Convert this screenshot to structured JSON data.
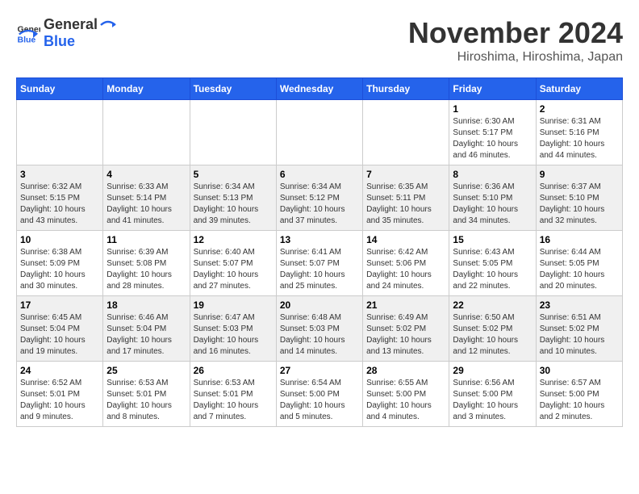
{
  "header": {
    "logo": {
      "general": "General",
      "blue": "Blue"
    },
    "title": "November 2024",
    "location": "Hiroshima, Hiroshima, Japan"
  },
  "calendar": {
    "weekdays": [
      "Sunday",
      "Monday",
      "Tuesday",
      "Wednesday",
      "Thursday",
      "Friday",
      "Saturday"
    ],
    "weeks": [
      [
        {
          "day": "",
          "info": ""
        },
        {
          "day": "",
          "info": ""
        },
        {
          "day": "",
          "info": ""
        },
        {
          "day": "",
          "info": ""
        },
        {
          "day": "",
          "info": ""
        },
        {
          "day": "1",
          "info": "Sunrise: 6:30 AM\nSunset: 5:17 PM\nDaylight: 10 hours\nand 46 minutes."
        },
        {
          "day": "2",
          "info": "Sunrise: 6:31 AM\nSunset: 5:16 PM\nDaylight: 10 hours\nand 44 minutes."
        }
      ],
      [
        {
          "day": "3",
          "info": "Sunrise: 6:32 AM\nSunset: 5:15 PM\nDaylight: 10 hours\nand 43 minutes."
        },
        {
          "day": "4",
          "info": "Sunrise: 6:33 AM\nSunset: 5:14 PM\nDaylight: 10 hours\nand 41 minutes."
        },
        {
          "day": "5",
          "info": "Sunrise: 6:34 AM\nSunset: 5:13 PM\nDaylight: 10 hours\nand 39 minutes."
        },
        {
          "day": "6",
          "info": "Sunrise: 6:34 AM\nSunset: 5:12 PM\nDaylight: 10 hours\nand 37 minutes."
        },
        {
          "day": "7",
          "info": "Sunrise: 6:35 AM\nSunset: 5:11 PM\nDaylight: 10 hours\nand 35 minutes."
        },
        {
          "day": "8",
          "info": "Sunrise: 6:36 AM\nSunset: 5:10 PM\nDaylight: 10 hours\nand 34 minutes."
        },
        {
          "day": "9",
          "info": "Sunrise: 6:37 AM\nSunset: 5:10 PM\nDaylight: 10 hours\nand 32 minutes."
        }
      ],
      [
        {
          "day": "10",
          "info": "Sunrise: 6:38 AM\nSunset: 5:09 PM\nDaylight: 10 hours\nand 30 minutes."
        },
        {
          "day": "11",
          "info": "Sunrise: 6:39 AM\nSunset: 5:08 PM\nDaylight: 10 hours\nand 28 minutes."
        },
        {
          "day": "12",
          "info": "Sunrise: 6:40 AM\nSunset: 5:07 PM\nDaylight: 10 hours\nand 27 minutes."
        },
        {
          "day": "13",
          "info": "Sunrise: 6:41 AM\nSunset: 5:07 PM\nDaylight: 10 hours\nand 25 minutes."
        },
        {
          "day": "14",
          "info": "Sunrise: 6:42 AM\nSunset: 5:06 PM\nDaylight: 10 hours\nand 24 minutes."
        },
        {
          "day": "15",
          "info": "Sunrise: 6:43 AM\nSunset: 5:05 PM\nDaylight: 10 hours\nand 22 minutes."
        },
        {
          "day": "16",
          "info": "Sunrise: 6:44 AM\nSunset: 5:05 PM\nDaylight: 10 hours\nand 20 minutes."
        }
      ],
      [
        {
          "day": "17",
          "info": "Sunrise: 6:45 AM\nSunset: 5:04 PM\nDaylight: 10 hours\nand 19 minutes."
        },
        {
          "day": "18",
          "info": "Sunrise: 6:46 AM\nSunset: 5:04 PM\nDaylight: 10 hours\nand 17 minutes."
        },
        {
          "day": "19",
          "info": "Sunrise: 6:47 AM\nSunset: 5:03 PM\nDaylight: 10 hours\nand 16 minutes."
        },
        {
          "day": "20",
          "info": "Sunrise: 6:48 AM\nSunset: 5:03 PM\nDaylight: 10 hours\nand 14 minutes."
        },
        {
          "day": "21",
          "info": "Sunrise: 6:49 AM\nSunset: 5:02 PM\nDaylight: 10 hours\nand 13 minutes."
        },
        {
          "day": "22",
          "info": "Sunrise: 6:50 AM\nSunset: 5:02 PM\nDaylight: 10 hours\nand 12 minutes."
        },
        {
          "day": "23",
          "info": "Sunrise: 6:51 AM\nSunset: 5:02 PM\nDaylight: 10 hours\nand 10 minutes."
        }
      ],
      [
        {
          "day": "24",
          "info": "Sunrise: 6:52 AM\nSunset: 5:01 PM\nDaylight: 10 hours\nand 9 minutes."
        },
        {
          "day": "25",
          "info": "Sunrise: 6:53 AM\nSunset: 5:01 PM\nDaylight: 10 hours\nand 8 minutes."
        },
        {
          "day": "26",
          "info": "Sunrise: 6:53 AM\nSunset: 5:01 PM\nDaylight: 10 hours\nand 7 minutes."
        },
        {
          "day": "27",
          "info": "Sunrise: 6:54 AM\nSunset: 5:00 PM\nDaylight: 10 hours\nand 5 minutes."
        },
        {
          "day": "28",
          "info": "Sunrise: 6:55 AM\nSunset: 5:00 PM\nDaylight: 10 hours\nand 4 minutes."
        },
        {
          "day": "29",
          "info": "Sunrise: 6:56 AM\nSunset: 5:00 PM\nDaylight: 10 hours\nand 3 minutes."
        },
        {
          "day": "30",
          "info": "Sunrise: 6:57 AM\nSunset: 5:00 PM\nDaylight: 10 hours\nand 2 minutes."
        }
      ]
    ]
  }
}
